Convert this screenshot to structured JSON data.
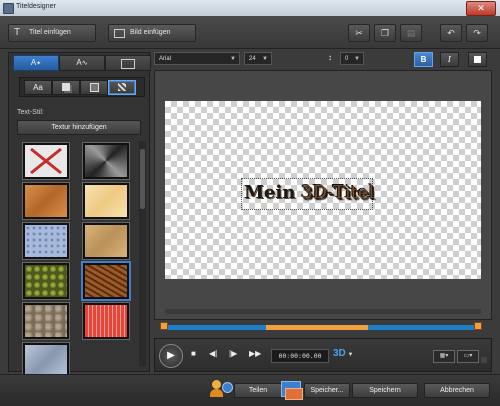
{
  "window": {
    "title": "Titeldesigner"
  },
  "toolbar": {
    "insert_title_label": "Titel einfügen",
    "insert_image_label": "Bild einfügen"
  },
  "left_panel": {
    "tabs": [
      "A",
      "A",
      ""
    ],
    "subtabs": [
      "Aa",
      "",
      "",
      ""
    ],
    "text_style_label": "Text-Stil:",
    "add_texture_label": "Textur hinzufügen",
    "textures": [
      {
        "name": "none",
        "colors": [
          "#e8e8e8",
          "#c22d2d"
        ]
      },
      {
        "name": "brushed-metal",
        "colors": [
          "#222222",
          "#9a9a9a"
        ]
      },
      {
        "name": "orange-crumpled",
        "colors": [
          "#d9904a",
          "#b3672b"
        ]
      },
      {
        "name": "cream-paper",
        "colors": [
          "#f7e3b3",
          "#efc982"
        ]
      },
      {
        "name": "blue-dots",
        "colors": [
          "#a9b9d9",
          "#6a86b8"
        ]
      },
      {
        "name": "tan-paper",
        "colors": [
          "#d8b47a",
          "#b9915a"
        ]
      },
      {
        "name": "green-scales",
        "colors": [
          "#98a63b",
          "#4e5a1d"
        ]
      },
      {
        "name": "brown-wood",
        "colors": [
          "#9b5a26",
          "#5a2c0f"
        ]
      },
      {
        "name": "gray-stone",
        "colors": [
          "#b5a48d",
          "#7a6c5a"
        ]
      },
      {
        "name": "red-fabric",
        "colors": [
          "#e8453a",
          "#f2a19a"
        ]
      },
      {
        "name": "blue-gray-noise",
        "colors": [
          "#bcc7d8",
          "#8797ae"
        ]
      }
    ]
  },
  "font_bar": {
    "font_name": "Arial",
    "font_size": "24",
    "spacing_value": "0",
    "bold_label": "B",
    "italic_label": "I"
  },
  "canvas": {
    "title_word1": "Mein",
    "title_word2": "3D-Titel"
  },
  "transport": {
    "timecode": "00:00:00.00",
    "three_d_label": "3D"
  },
  "footer": {
    "share_label": "Teilen",
    "save_as_label": "Speicher...",
    "save_label": "Speichern",
    "cancel_label": "Abbrechen"
  },
  "colors": {
    "accent_blue": "#1e7fc9",
    "timeline_orange": "#f0a040",
    "panel_dark": "#333333"
  }
}
